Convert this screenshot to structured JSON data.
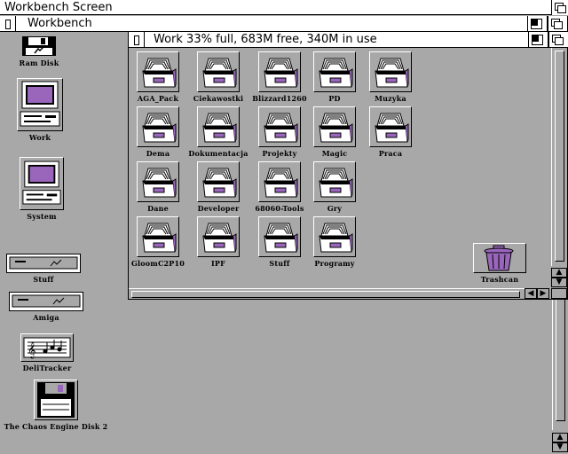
{
  "screen": {
    "title": "Workbench Screen"
  },
  "backdrop": {
    "title": "Workbench"
  },
  "work_window": {
    "title": "Work  33% full, 683M free, 340M in use",
    "drawers": [
      "AGA_Pack",
      "Ciekawostki",
      "Blizzard1260",
      "PD",
      "Muzyka",
      "Dema",
      "Dokumentacja",
      "Projekty",
      "Magic",
      "Praca",
      "Dane",
      "Developer",
      "68060-Tools",
      "Gry",
      "GloomC2P10",
      "IPF",
      "Stuff",
      "Programy"
    ],
    "trashcan": "Trashcan"
  },
  "desktop_icons": {
    "ram_disk": "Ram Disk",
    "work": "Work",
    "system": "System",
    "stuff": "Stuff",
    "amiga": "Amiga",
    "delitracker": "DeliTracker",
    "chaos": "The Chaos Engine Disk 2"
  },
  "colors": {
    "background": "#a8a8a8",
    "highlight": "#ffffff",
    "shadow": "#000000",
    "accent": "#9966bb"
  },
  "icons": {
    "drawer": "filing-drawer-icon",
    "hdd": "computer-icon",
    "disk": "floppy-icon",
    "trash": "trashcan-icon"
  }
}
